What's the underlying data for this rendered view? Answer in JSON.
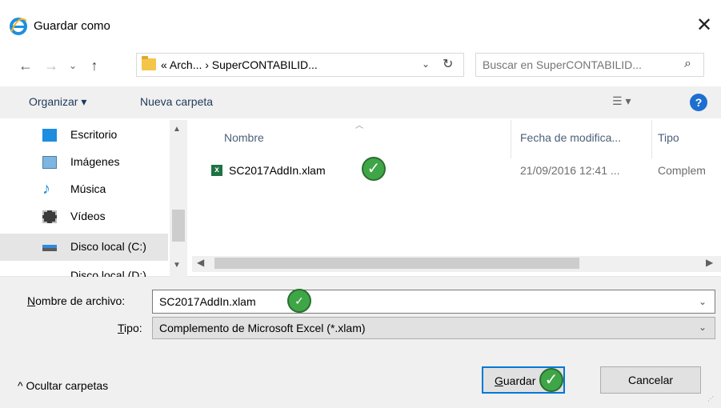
{
  "window": {
    "title": "Guardar como",
    "app_icon": "internet-explorer-icon",
    "close_glyph": "✕"
  },
  "nav": {
    "back_glyph": "←",
    "forward_glyph": "→",
    "recent_glyph": "⌄",
    "up_glyph": "↑",
    "address_path": "« Arch... › SuperCONTABILID...",
    "address_dropdown_glyph": "⌄",
    "refresh_glyph": "↻",
    "search_placeholder": "Buscar en SuperCONTABILID...",
    "search_glyph": "⌕"
  },
  "toolbar": {
    "organize_label": "Organizar ▾",
    "new_folder_label": "Nueva carpeta",
    "view_glyph": "☰ ▾",
    "help_glyph": "?"
  },
  "sidebar": {
    "items": [
      {
        "label": "Escritorio",
        "icon": "desktop-icon"
      },
      {
        "label": "Imágenes",
        "icon": "pictures-icon"
      },
      {
        "label": "Música",
        "icon": "music-icon"
      },
      {
        "label": "Vídeos",
        "icon": "videos-icon"
      },
      {
        "label": "Disco local (C:)",
        "icon": "drive-icon",
        "selected": true
      },
      {
        "label": "Disco local (D:)",
        "icon": "drive-icon"
      }
    ]
  },
  "file_list": {
    "columns": [
      "Nombre",
      "Fecha de modifica...",
      "Tipo"
    ],
    "rows": [
      {
        "name": "SC2017AddIn.xlam",
        "date": "21/09/2016 12:41 ...",
        "type": "Complem"
      }
    ]
  },
  "form": {
    "filename_label_underlined": "N",
    "filename_label_rest": "ombre de archivo:",
    "filename_value": "SC2017AddIn.xlam",
    "type_label_underlined": "T",
    "type_label_rest": "ipo:",
    "type_value": "Complemento de Microsoft Excel (*.xlam)",
    "dropdown_glyph": "⌄"
  },
  "footer": {
    "hide_folders_label": "^  Ocultar carpetas",
    "save_underlined": "G",
    "save_rest": "uardar",
    "cancel_label": "Cancelar"
  },
  "badges": {
    "check_glyph": "✓",
    "color": "#3ea647"
  }
}
